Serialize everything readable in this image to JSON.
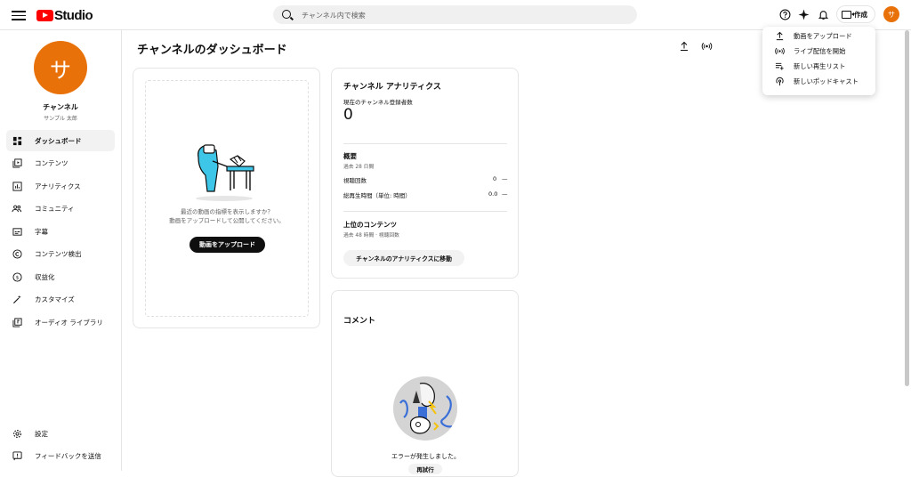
{
  "header": {
    "logo_text": "Studio",
    "search_placeholder": "チャンネル内で検索",
    "create_label": "作成",
    "avatar_initial": "サ"
  },
  "sidebar": {
    "avatar_initial": "サ",
    "channel_label": "チャンネル",
    "channel_name": "サンプル 太郎",
    "items": [
      {
        "label": "ダッシュボード",
        "icon": "dashboard-icon",
        "active": true
      },
      {
        "label": "コンテンツ",
        "icon": "content-icon"
      },
      {
        "label": "アナリティクス",
        "icon": "analytics-icon"
      },
      {
        "label": "コミュニティ",
        "icon": "community-icon"
      },
      {
        "label": "字幕",
        "icon": "subtitles-icon"
      },
      {
        "label": "コンテンツ検出",
        "icon": "copyright-icon"
      },
      {
        "label": "収益化",
        "icon": "monetization-icon"
      },
      {
        "label": "カスタマイズ",
        "icon": "customize-icon"
      },
      {
        "label": "オーディオ ライブラリ",
        "icon": "audio-library-icon"
      }
    ],
    "bottom": [
      {
        "label": "設定",
        "icon": "settings-icon"
      },
      {
        "label": "フィードバックを送信",
        "icon": "feedback-icon"
      }
    ]
  },
  "main": {
    "title": "チャンネルのダッシュボード",
    "upload_card": {
      "line1": "最近の動画の指標を表示しますか？",
      "line2": "動画をアップロードして公開してください。",
      "button": "動画をアップロード"
    },
    "analytics_card": {
      "title": "チャンネル アナリティクス",
      "subscribers_label": "現在のチャンネル登録者数",
      "subscribers_value": "0",
      "summary_title": "概要",
      "summary_period": "過去 28 日間",
      "metrics": [
        {
          "label": "視聴回数",
          "value": "0",
          "trend": "—"
        },
        {
          "label": "総再生時間（単位: 時間）",
          "value": "0.0",
          "trend": "—"
        }
      ],
      "top_content_title": "上位のコンテンツ",
      "top_content_period": "過去 48 時間 · 視聴回数",
      "button": "チャンネルのアナリティクスに移動"
    },
    "comments_card": {
      "title": "コメント",
      "error": "エラーが発生しました。",
      "retry": "再試行"
    }
  },
  "create_menu": {
    "items": [
      {
        "label": "動画をアップロード",
        "icon": "upload-icon"
      },
      {
        "label": "ライブ配信を開始",
        "icon": "live-icon"
      },
      {
        "label": "新しい再生リスト",
        "icon": "playlist-add-icon"
      },
      {
        "label": "新しいポッドキャスト",
        "icon": "podcast-icon"
      }
    ]
  },
  "colors": {
    "accent": "#e8710a",
    "brand_red": "#ff0000",
    "illustration_blue": "#3ec6e8"
  }
}
